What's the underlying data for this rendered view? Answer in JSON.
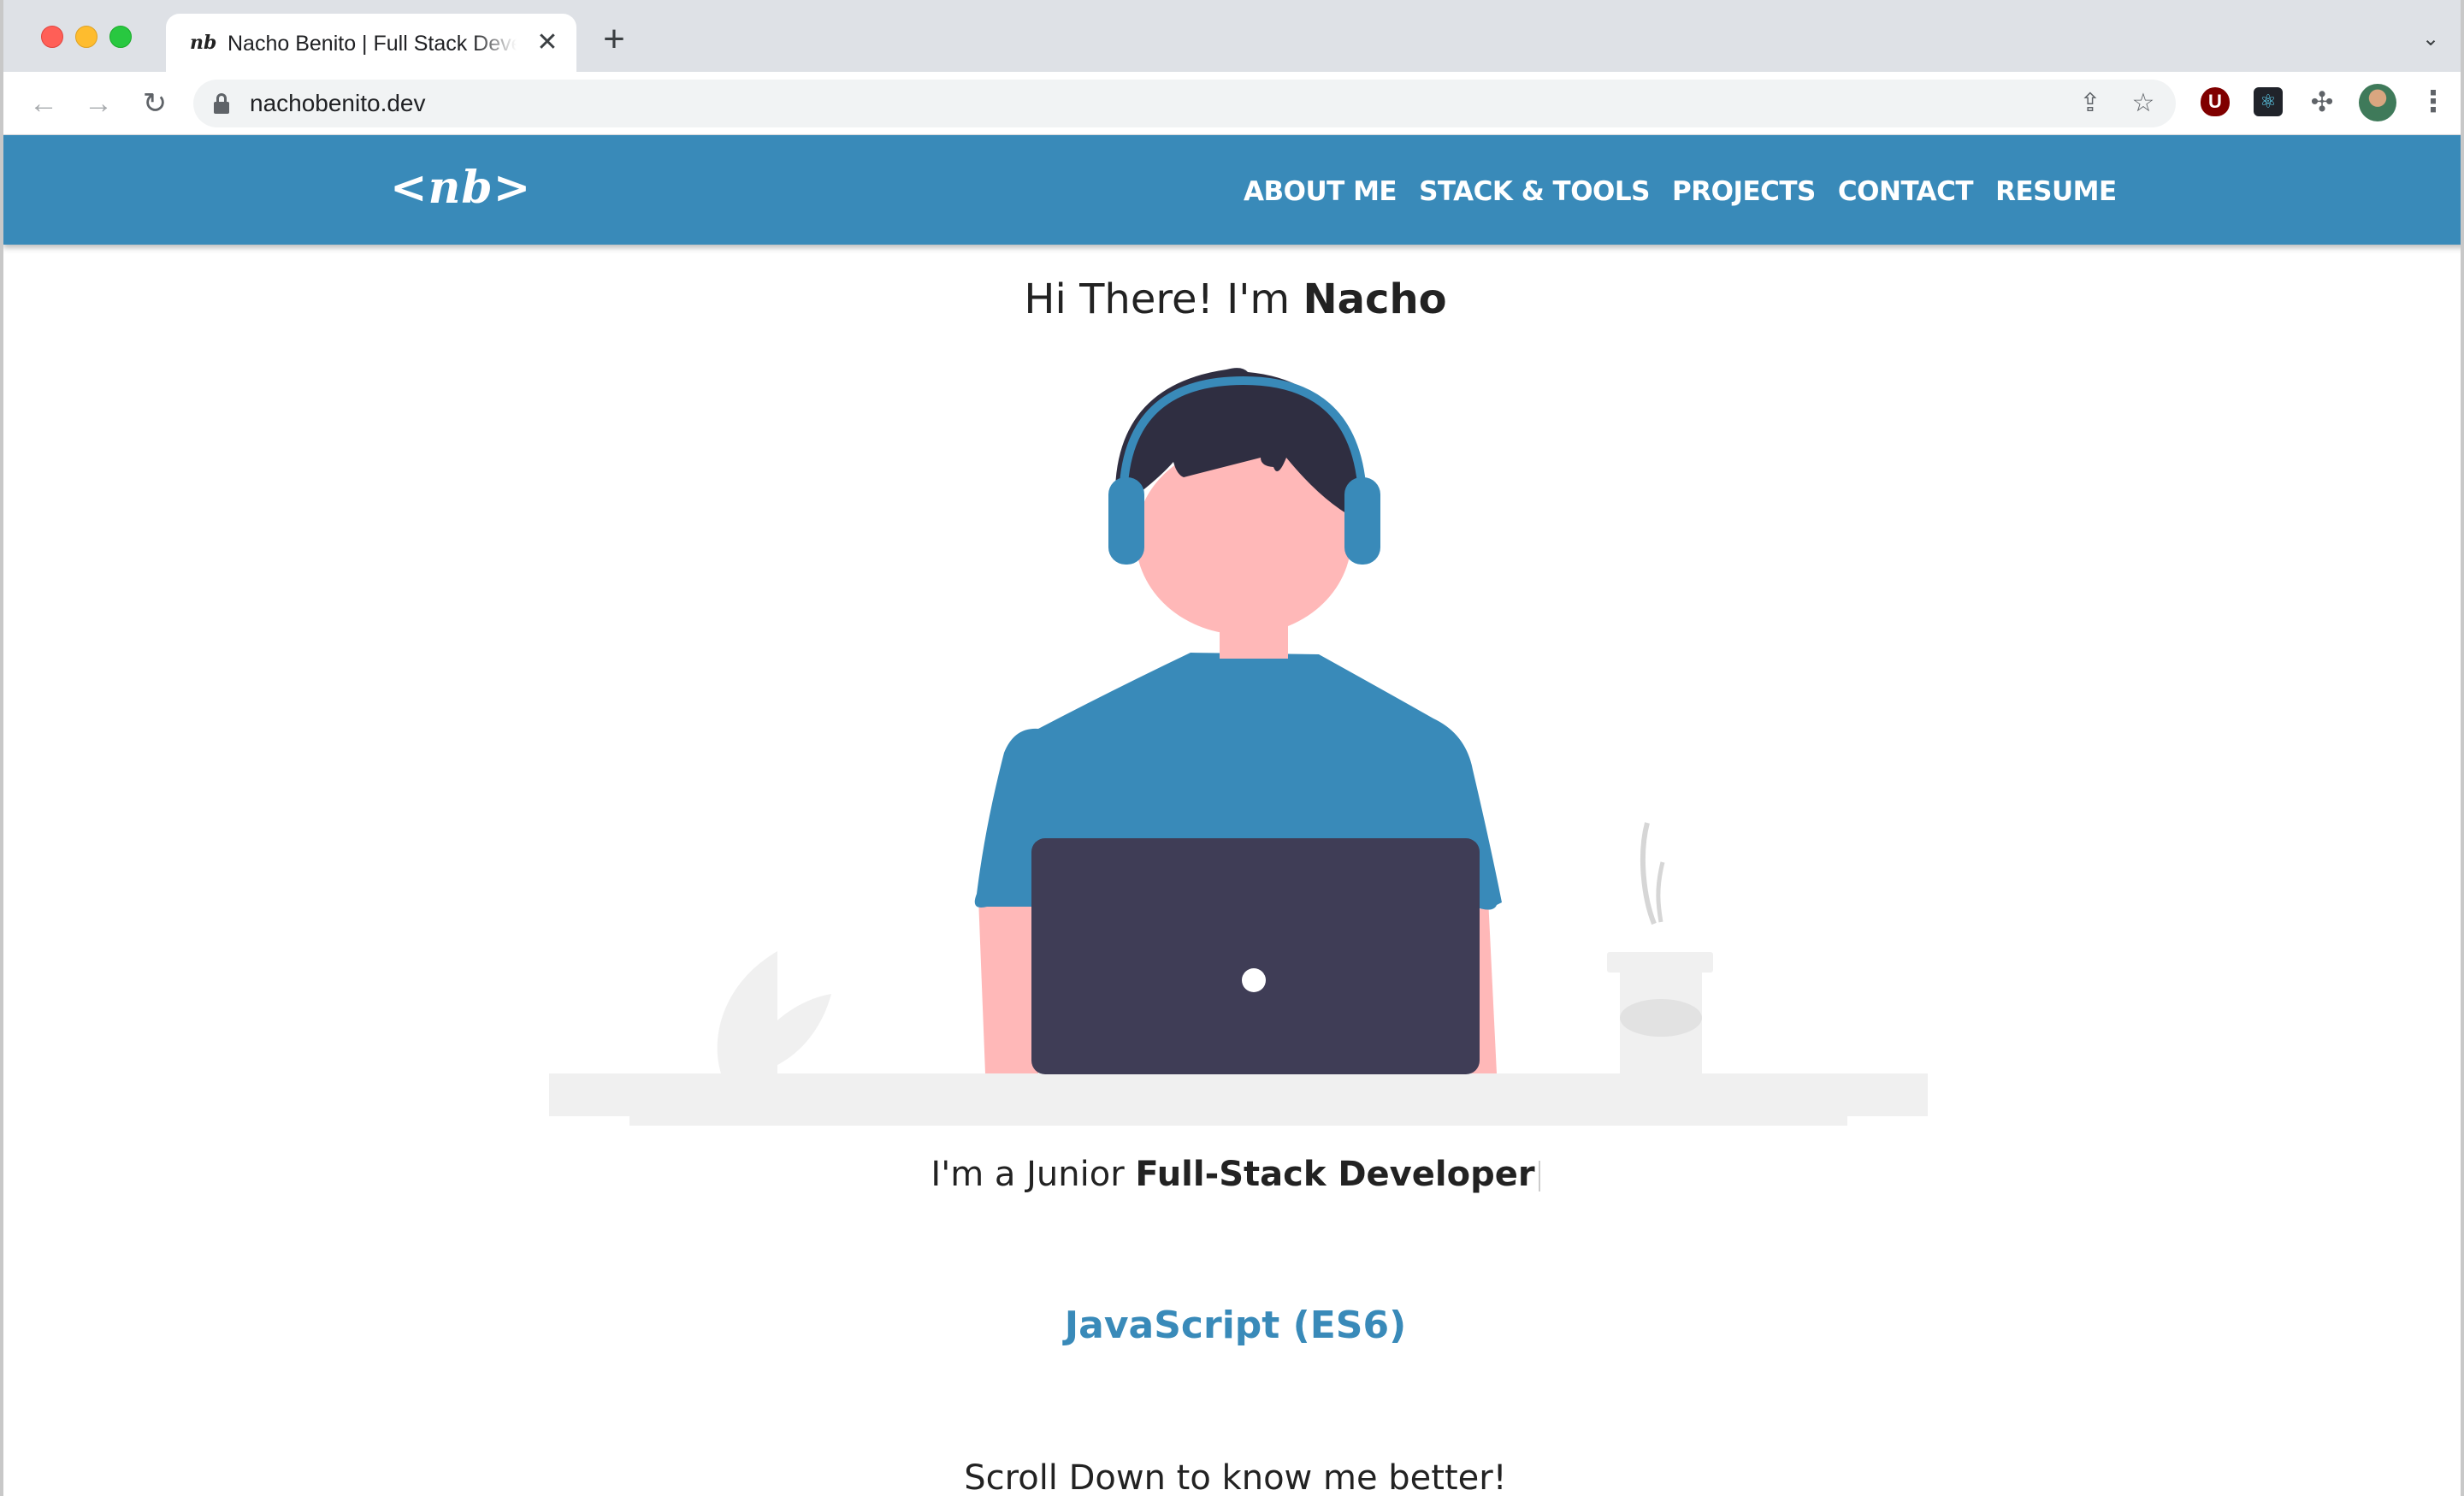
{
  "browser": {
    "tab_title": "Nacho Benito | Full Stack Developer",
    "tab_favicon_text": "nb",
    "close_glyph": "✕",
    "new_tab_glyph": "+",
    "tab_menu_glyph": "⌄",
    "url": "nachobenito.dev",
    "icons": {
      "back": "arrow-left-icon",
      "forward": "arrow-right-icon",
      "reload": "reload-icon",
      "lock": "lock-icon",
      "share": "share-icon",
      "bookmark": "star-icon",
      "extensions": [
        "ublock-icon",
        "react-devtools-icon",
        "puzzle-icon",
        "profile-avatar",
        "kebab-menu-icon"
      ]
    },
    "back_glyph": "←",
    "forward_glyph": "→",
    "reload_glyph": "↻",
    "share_glyph": "⇪",
    "star_glyph": "☆",
    "ublock_glyph": "U",
    "react_glyph": "⚛",
    "puzzle_glyph": "✣",
    "menu_glyph": "⋮"
  },
  "site": {
    "logo": "<nb>",
    "brand_color": "#398ab9",
    "nav": [
      "ABOUT ME",
      "STACK & TOOLS",
      "PROJECTS",
      "CONTACT",
      "RESUME"
    ],
    "greeting_prefix": "Hi There! I'm ",
    "greeting_name": "Nacho",
    "subtitle_prefix": "I'm a Junior ",
    "subtitle_role": "Full-Stack Developer",
    "skill": "JavaScript (ES6)",
    "scroll_hint": "Scroll Down to know me better!"
  },
  "illustration": {
    "subject": "developer-with-headphones-at-laptop",
    "colors": {
      "shirt": "#398ab9",
      "skin": "#ffb8b8",
      "hair": "#2f2e41",
      "laptop": "#3f3d56",
      "desk": "#f0f0f0"
    }
  }
}
